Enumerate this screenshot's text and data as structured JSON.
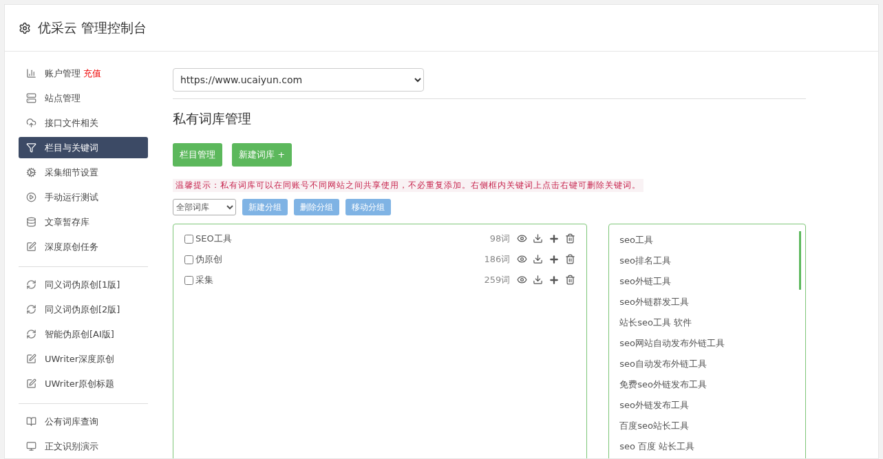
{
  "header": {
    "title": "优采云 管理控制台"
  },
  "sidebar": {
    "groups": [
      {
        "items": [
          {
            "label": "账户管理",
            "badge": "充值",
            "selected": false
          },
          {
            "label": "站点管理",
            "selected": false
          },
          {
            "label": "接口文件相关",
            "selected": false
          },
          {
            "label": "栏目与关键词",
            "selected": true
          },
          {
            "label": "采集细节设置",
            "selected": false
          },
          {
            "label": "手动运行测试",
            "selected": false
          },
          {
            "label": "文章暂存库",
            "selected": false
          },
          {
            "label": "深度原创任务",
            "selected": false
          }
        ]
      },
      {
        "items": [
          {
            "label": "同义词伪原创[1版]",
            "selected": false
          },
          {
            "label": "同义词伪原创[2版]",
            "selected": false
          },
          {
            "label": "智能伪原创[AI版]",
            "selected": false
          },
          {
            "label": "UWriter深度原创",
            "selected": false
          },
          {
            "label": "UWriter原创标题",
            "selected": false
          }
        ]
      },
      {
        "items": [
          {
            "label": "公有词库查询",
            "selected": false
          },
          {
            "label": "正文识别演示",
            "selected": false
          }
        ]
      }
    ]
  },
  "site_select": {
    "value": "https://www.ucaiyun.com"
  },
  "page_title": "私有词库管理",
  "actions": [
    "栏目管理",
    "新建词库 +"
  ],
  "tip": "温馨提示：私有词库可以在同账号不同网站之间共享使用，不必重复添加。右侧框内关键词上点击右键可删除关键词。",
  "group_select": {
    "value": "全部词库"
  },
  "group_buttons": [
    "新建分组",
    "删除分组",
    "移动分组"
  ],
  "libraries": [
    {
      "name": "SEO工具",
      "count": "98词",
      "checked": false
    },
    {
      "name": "伪原创",
      "count": "186词",
      "checked": false
    },
    {
      "name": "采集",
      "count": "259词",
      "checked": false
    }
  ],
  "keywords": [
    "seo工具",
    "seo排名工具",
    "seo外链工具",
    "seo外链群发工具",
    "站长seo工具 软件",
    "seo网站自动发布外链工具",
    "seo自动发布外链工具",
    "免费seo外链发布工具",
    "seo外链发布工具",
    "百度seo站长工具",
    "seo 百度 站长工具"
  ]
}
